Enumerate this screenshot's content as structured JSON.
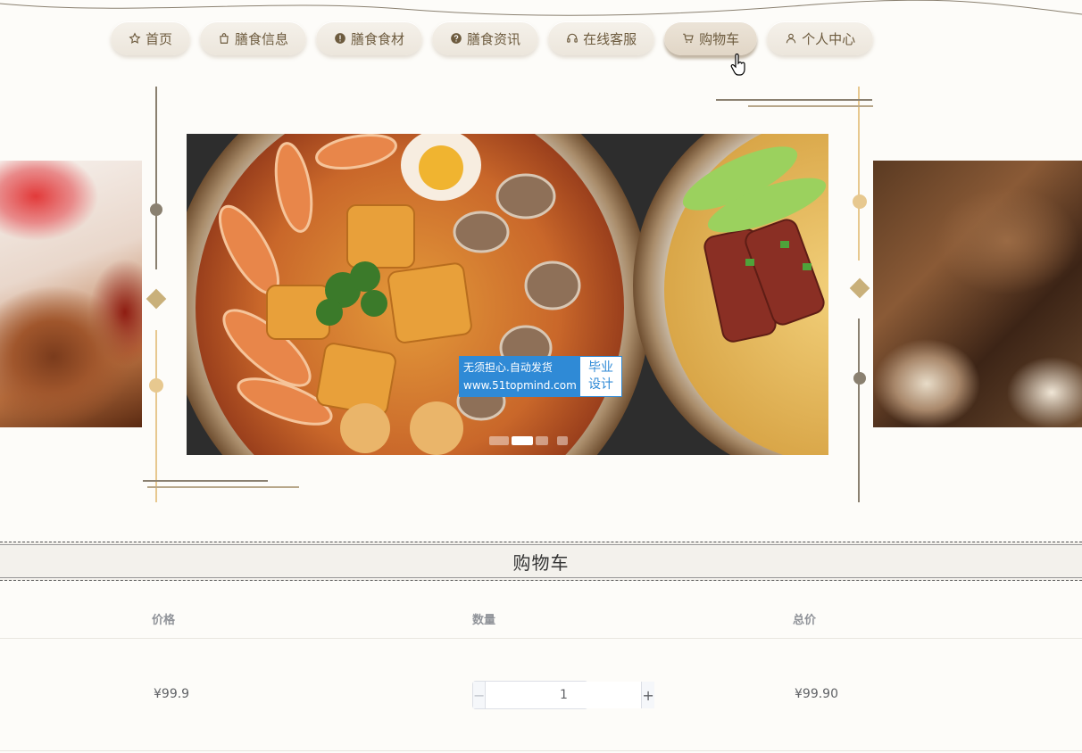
{
  "nav": {
    "items": [
      {
        "label": "首页",
        "icon": "star-icon"
      },
      {
        "label": "膳食信息",
        "icon": "bag-icon"
      },
      {
        "label": "膳食食材",
        "icon": "alert-circle-icon"
      },
      {
        "label": "膳食资讯",
        "icon": "question-circle-icon"
      },
      {
        "label": "在线客服",
        "icon": "headset-icon"
      },
      {
        "label": "购物车",
        "icon": "cart-icon",
        "active": true
      },
      {
        "label": "个人中心",
        "icon": "user-icon"
      }
    ]
  },
  "watermark": {
    "line1": "无须担心.自动发货",
    "line2": "www.51topmind.com",
    "right1": "毕业",
    "right2": "设计"
  },
  "section": {
    "title": "购物车"
  },
  "cart": {
    "columns": [
      "价格",
      "数量",
      "总价"
    ],
    "rows": [
      {
        "price": "¥99.9",
        "quantity": "1",
        "total": "¥99.90"
      }
    ]
  },
  "colors": {
    "accent": "#6d5b3e",
    "gold": "#e7c88f",
    "line": "#8a8070"
  }
}
